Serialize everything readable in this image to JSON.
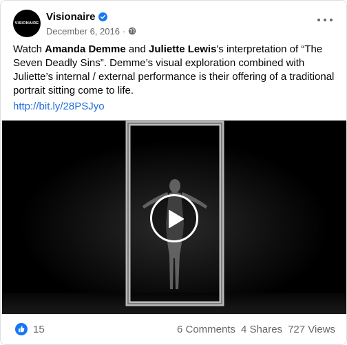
{
  "post": {
    "page_name": "Visionaire",
    "avatar_text": "VISIONAIRE",
    "date": "December 6, 2016",
    "separator": "·",
    "icons": {
      "verified": "verified-badge-icon",
      "privacy": "globe-icon",
      "more": "more-options-icon",
      "like": "like-thumb-icon",
      "play": "play-icon"
    },
    "text": {
      "p1": "Watch ",
      "name1": "Amanda Demme",
      "p2": " and ",
      "name2": "Juliette Lewis",
      "p3": "'s interpretation of “The Seven Deadly Sins”. Demme’s visual exploration combined with Juliette’s internal / external performance is their offering of a traditional portrait sitting come to life."
    },
    "link": "http://bit.ly/28PSJyo"
  },
  "engagement": {
    "likes": "15",
    "comments": "6 Comments",
    "shares": "4 Shares",
    "views": "727 Views"
  },
  "colors": {
    "accent": "#216fdb",
    "secondary_text": "#65676b",
    "verified": "#1877f2"
  }
}
